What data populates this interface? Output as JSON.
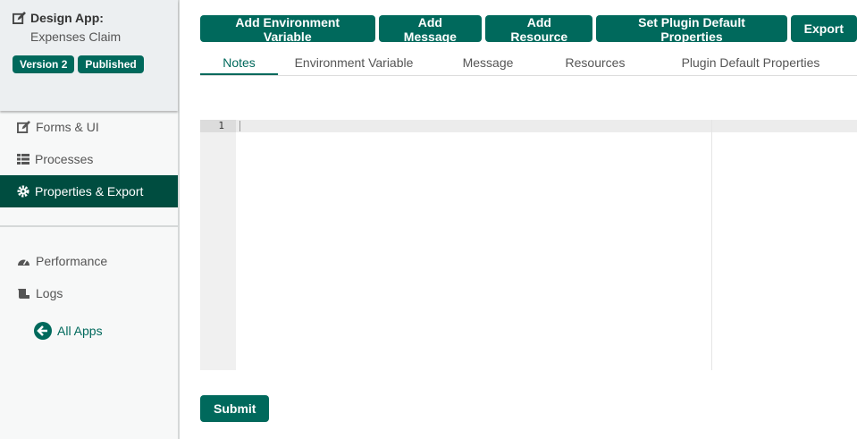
{
  "sidebar": {
    "app_label": "Design App:",
    "app_name": "Expenses Claim",
    "badges": [
      "Version 2",
      "Published"
    ],
    "items": [
      {
        "label": "Forms & UI",
        "icon": "edit-icon"
      },
      {
        "label": "Processes",
        "icon": "list-icon"
      },
      {
        "label": "Properties & Export",
        "icon": "gear-icon",
        "active": true
      }
    ],
    "items2": [
      {
        "label": "Performance",
        "icon": "gauge-icon"
      },
      {
        "label": "Logs",
        "icon": "scroll-icon"
      }
    ],
    "all_apps": "All Apps"
  },
  "toolbar": [
    "Add Environment Variable",
    "Add Message",
    "Add Resource",
    "Set Plugin Default Properties",
    "Export"
  ],
  "tabs": [
    "Notes",
    "Environment Variable",
    "Message",
    "Resources",
    "Plugin Default Properties"
  ],
  "editor": {
    "line": "1"
  },
  "submit": "Submit",
  "colors": {
    "primary": "#00695c",
    "active": "#004d40"
  }
}
